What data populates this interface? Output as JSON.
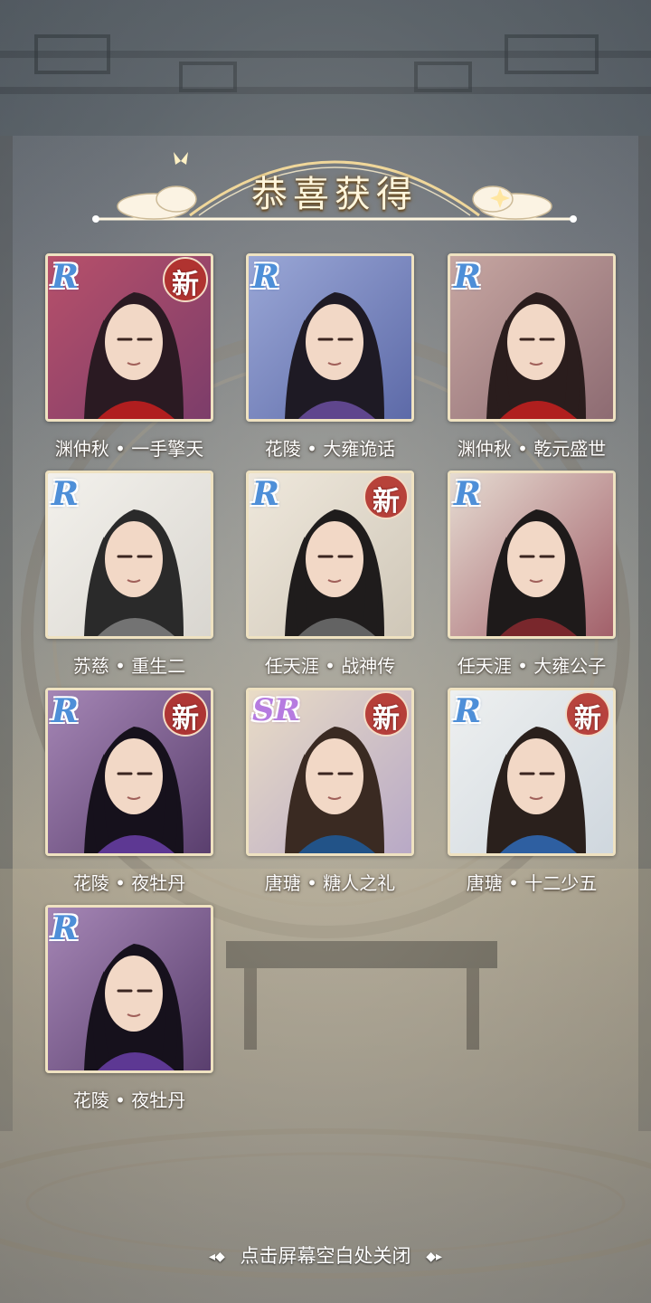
{
  "title": "恭喜获得",
  "new_label": "新",
  "footer_hint": "点击屏幕空白处关闭",
  "colors": {
    "card_border": "#efe2c1",
    "rarity_r": "#4e8fd8",
    "rarity_sr": "#b67be0",
    "badge_red": "#b2312a"
  },
  "cards": [
    {
      "rarity": "R",
      "is_new": true,
      "name": "渊仲秋 • 一手擎天",
      "palette": [
        "#7c3d6a",
        "#b7506a",
        "#2a1a22"
      ],
      "accent": "#c8201e"
    },
    {
      "rarity": "R",
      "is_new": false,
      "name": "花陵 • 大雍诡话",
      "palette": [
        "#5d6aa8",
        "#9aa7d6",
        "#1e1a24"
      ],
      "accent": "#6b4fa0"
    },
    {
      "rarity": "R",
      "is_new": false,
      "name": "渊仲秋 • 乾元盛世",
      "palette": [
        "#8d6b72",
        "#c7a7a2",
        "#2a1d1d"
      ],
      "accent": "#c8201e"
    },
    {
      "rarity": "R",
      "is_new": false,
      "name": "苏慈 • 重生二",
      "palette": [
        "#d9d6d0",
        "#f3f1ec",
        "#2a2a2a"
      ],
      "accent": "#808080"
    },
    {
      "rarity": "R",
      "is_new": true,
      "name": "任天涯 • 战神传",
      "palette": [
        "#cfc7b8",
        "#efe8dc",
        "#1f1c1c"
      ],
      "accent": "#707070"
    },
    {
      "rarity": "R",
      "is_new": false,
      "name": "任天涯 • 大雍公子",
      "palette": [
        "#a2606a",
        "#e6dcd2",
        "#1e1a1a"
      ],
      "accent": "#8a2a30"
    },
    {
      "rarity": "R",
      "is_new": true,
      "name": "花陵 • 夜牡丹",
      "palette": [
        "#5a3f6e",
        "#a586b5",
        "#16111c"
      ],
      "accent": "#6a3fa8"
    },
    {
      "rarity": "SR",
      "is_new": true,
      "name": "唐瑭 • 糖人之礼",
      "palette": [
        "#b8a9c6",
        "#e9dcc6",
        "#3a2a22"
      ],
      "accent": "#1f5a9a"
    },
    {
      "rarity": "R",
      "is_new": true,
      "name": "唐瑭 • 十二少五",
      "palette": [
        "#cfd7de",
        "#eef0f0",
        "#2a201c"
      ],
      "accent": "#2f6bb8"
    },
    {
      "rarity": "R",
      "is_new": false,
      "name": "花陵 • 夜牡丹",
      "palette": [
        "#5a3f6e",
        "#a586b5",
        "#16111c"
      ],
      "accent": "#6a3fa8"
    }
  ]
}
